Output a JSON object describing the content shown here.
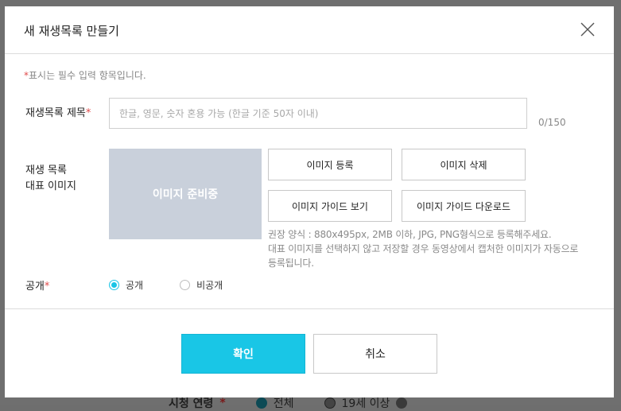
{
  "modal": {
    "title": "새 재생목록 만들기",
    "required_notice": "표시는 필수 입력 항목입니다.",
    "required_marker": "*"
  },
  "playlist_title": {
    "label": "재생목록 제목",
    "placeholder": "한글, 영문, 숫자 혼용 가능 (한글 기준 50자 이내)",
    "value": "",
    "counter": "0/150"
  },
  "thumbnail": {
    "label_line1": "재생 목록",
    "label_line2": "대표 이미지",
    "placeholder_text": "이미지 준비중",
    "buttons": {
      "register": "이미지 등록",
      "delete": "이미지 삭제",
      "guide_view": "이미지 가이드 보기",
      "guide_download": "이미지 가이드 다운로드"
    },
    "help_line1": "권장 양식 : 880x495px, 2MB 이하, JPG, PNG형식으로 등록해주세요.",
    "help_line2": "대표 이미지를 선택하지 않고 저장할 경우 동영상에서 캡처한 이미지가 자동으로 등록됩니다."
  },
  "visibility": {
    "label": "공개",
    "options": [
      {
        "label": "공개",
        "selected": true
      },
      {
        "label": "비공개",
        "selected": false
      }
    ]
  },
  "footer": {
    "confirm": "확인",
    "cancel": "취소"
  },
  "background": {
    "row_label": "시청 연령",
    "option_all": "전체",
    "option_19": "19세 이상"
  },
  "colors": {
    "accent": "#19c6e6",
    "required": "#e04b4b",
    "image_placeholder": "#c9d0db"
  }
}
